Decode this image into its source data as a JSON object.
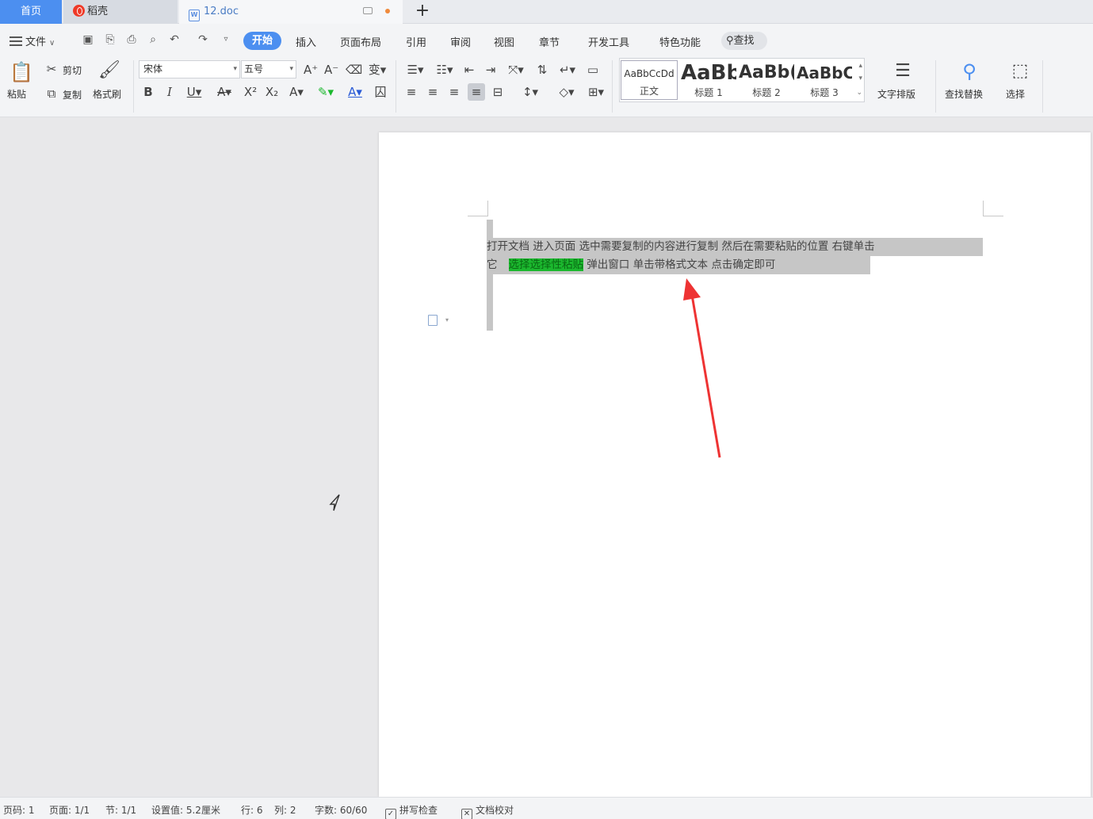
{
  "tabs": {
    "home": "首页",
    "daoke": "稻壳",
    "document": "12.doc",
    "new_tab": "+"
  },
  "menu": {
    "file": "文件",
    "items": [
      "开始",
      "插入",
      "页面布局",
      "引用",
      "审阅",
      "视图",
      "章节",
      "开发工具",
      "特色功能"
    ],
    "active": "开始",
    "search": "查找"
  },
  "ribbon": {
    "paste": "粘贴",
    "cut": "剪切",
    "copy": "复制",
    "format_painter": "格式刷",
    "font_name": "宋体",
    "font_size": "五号",
    "styles": [
      {
        "sample": "AaBbCcDd",
        "name": "正文"
      },
      {
        "sample": "AaBb",
        "name": "标题 1"
      },
      {
        "sample": "AaBb(",
        "name": "标题 2"
      },
      {
        "sample": "AaBbC",
        "name": "标题 3"
      }
    ],
    "text_layout": "文字排版",
    "find_replace": "查找替换",
    "select": "选择"
  },
  "document": {
    "line1": "打开文档    进入页面   选中需要复制的内容进行复制   然后在需要粘贴的位置   右键单击",
    "line2_prefix": "它",
    "line2_highlight": "选择选择性粘贴",
    "line2_rest": "  弹出窗口      单击带格式文本   点击确定即可"
  },
  "status": {
    "page_no": "页码: 1",
    "pages": "页面: 1/1",
    "section": "节: 1/1",
    "setting": "设置值: 5.2厘米",
    "row": "行: 6",
    "col": "列: 2",
    "word_count": "字数: 60/60",
    "spell_check": "拼写检查",
    "doc_proof": "文档校对"
  },
  "colors": {
    "accent": "#4c8ff0",
    "highlight": "#1bb82e",
    "arrow": "#ee3333"
  }
}
